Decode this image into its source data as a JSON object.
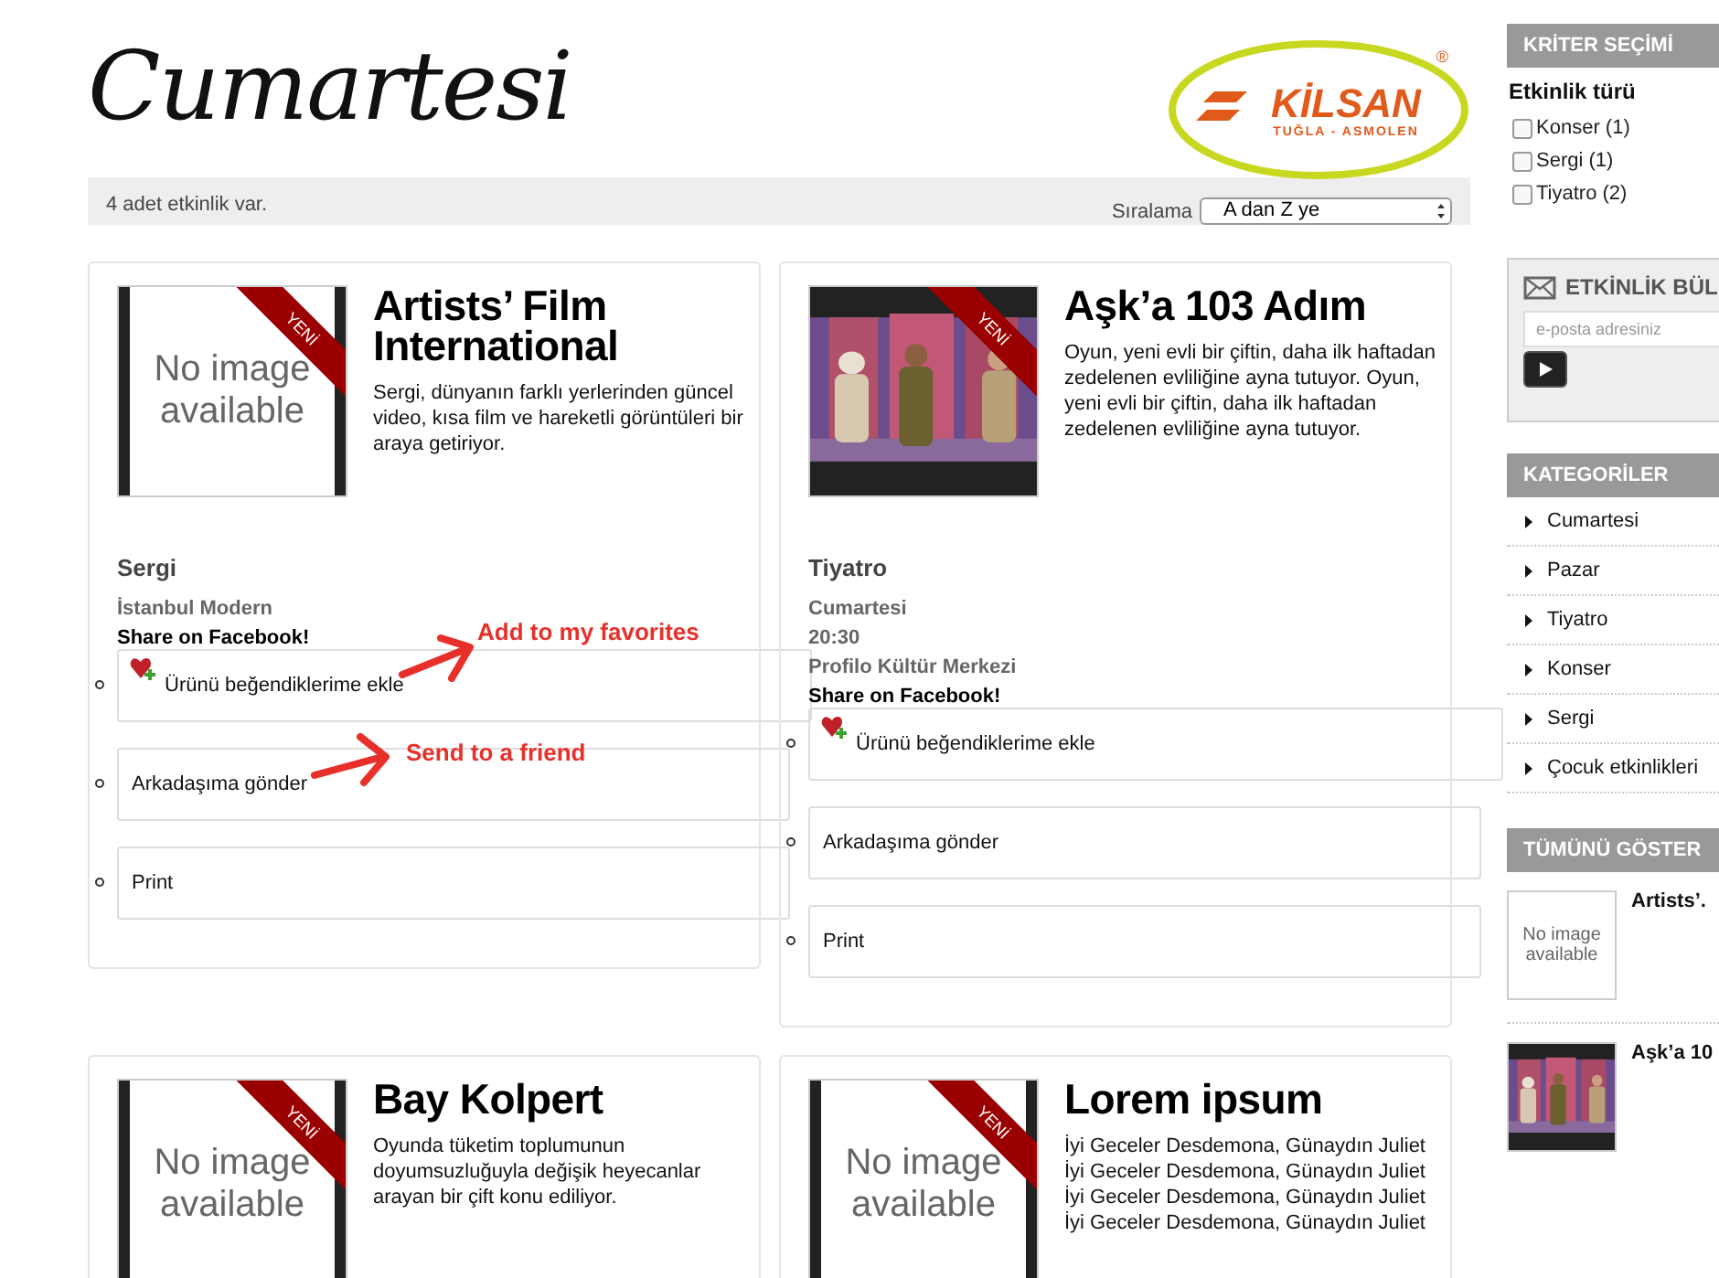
{
  "header": {
    "title": "Cumartesi",
    "logo": {
      "name": "KİLSAN",
      "mark": "®",
      "tagline": "TUĞLA - ASMOLEN"
    }
  },
  "summary": {
    "count_text": "4 adet etkinlik var.",
    "sort_label": "Sıralama",
    "sort_value": "A dan Z ye"
  },
  "events": [
    {
      "title": "Artists’ Film International",
      "image": {
        "kind": "placeholder",
        "text": "No image available"
      },
      "ribbon": "YENİ",
      "description": [
        "Sergi, dünyanın farklı yerlerinden güncel video, kısa film ve hareketli görüntüleri bir araya getiriyor."
      ],
      "category": "Sergi",
      "details": [
        "İstanbul Modern"
      ],
      "share": "Share on Facebook!",
      "actions": [
        {
          "kind": "favorite",
          "label": "Ürünü beğendiklerime ekle"
        },
        {
          "kind": "send",
          "label": "Arkadaşıma gönder"
        },
        {
          "kind": "print",
          "label": "Print"
        }
      ]
    },
    {
      "title": "Aşk’a 103 Adım",
      "image": {
        "kind": "picture"
      },
      "ribbon": "YENİ",
      "description": [
        "Oyun, yeni evli bir çiftin, daha ilk haftadan zedelenen evliliğine ayna tutuyor. Oyun, yeni evli bir çiftin, daha ilk haftadan zedelenen evliliğine ayna tutuyor."
      ],
      "category": "Tiyatro",
      "details": [
        "Cumartesi",
        "20:30",
        "Profilo Kültür Merkezi"
      ],
      "share": "Share on Facebook!",
      "actions": [
        {
          "kind": "favorite",
          "label": "Ürünü beğendiklerime ekle"
        },
        {
          "kind": "send",
          "label": "Arkadaşıma gönder"
        },
        {
          "kind": "print",
          "label": "Print"
        }
      ]
    },
    {
      "title": "Bay Kolpert",
      "image": {
        "kind": "placeholder",
        "text": "No image available"
      },
      "ribbon": "YENİ",
      "description": [
        "Oyunda tüketim toplumunun doyumsuzluğuyla değişik heyecanlar arayan bir çift konu ediliyor."
      ]
    },
    {
      "title": "Lorem ipsum",
      "image": {
        "kind": "placeholder",
        "text": "No image available"
      },
      "ribbon": "YENİ",
      "description": [
        "İyi Geceler Desdemona, Günaydın Juliet",
        "İyi Geceler Desdemona, Günaydın Juliet",
        "İyi Geceler Desdemona, Günaydın Juliet",
        "İyi Geceler Desdemona, Günaydın Juliet"
      ]
    }
  ],
  "annotations": [
    {
      "text": "Add to my favorites"
    },
    {
      "text": "Send to a friend"
    }
  ],
  "sidebar": {
    "criteria": {
      "header": "KRİTER SEÇİMİ",
      "group": "Etkinlik türü",
      "options": [
        {
          "label": "Konser (1)",
          "checked": false
        },
        {
          "label": "Sergi (1)",
          "checked": false
        },
        {
          "label": "Tiyatro (2)",
          "checked": false
        }
      ]
    },
    "newsletter": {
      "header": "ETKİNLİK BÜL",
      "placeholder": "e-posta adresiniz"
    },
    "categories": {
      "header": "KATEGORİLER",
      "items": [
        "Cumartesi",
        "Pazar",
        "Tiyatro",
        "Konser",
        "Sergi",
        "Çocuk etkinlikleri"
      ]
    },
    "all": {
      "header": "TÜMÜNÜ GÖSTER",
      "items": [
        {
          "image": {
            "kind": "placeholder",
            "text": "No image available"
          },
          "title": "Artists’."
        },
        {
          "image": {
            "kind": "picture"
          },
          "title": "Aşk’a 10"
        }
      ]
    }
  }
}
